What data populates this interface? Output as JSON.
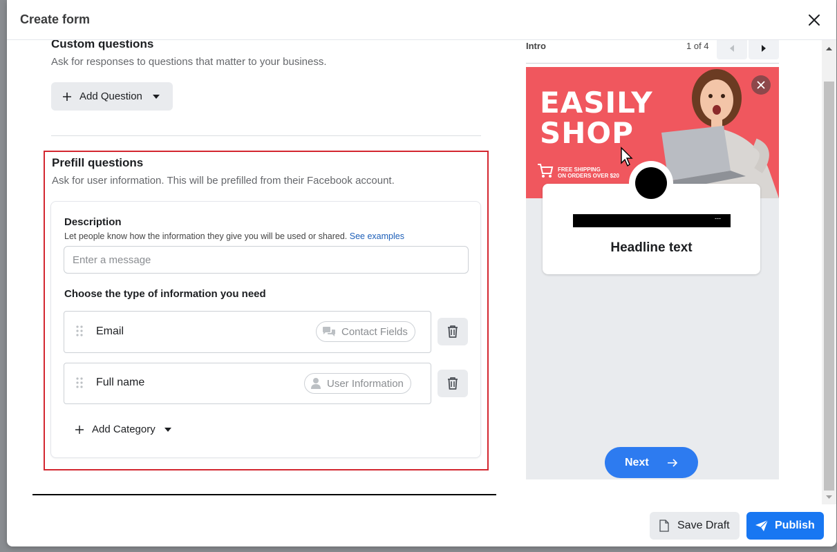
{
  "modal": {
    "title": "Create form"
  },
  "custom_questions": {
    "title": "Custom questions",
    "subtitle": "Ask for responses to questions that matter to your business.",
    "add_button": "Add Question"
  },
  "prefill": {
    "title": "Prefill questions",
    "subtitle": "Ask for user information. This will be prefilled from their Facebook account.",
    "description_label": "Description",
    "description_help": "Let people know how the information they give you will be used or shared.",
    "see_examples": "See examples",
    "message_placeholder": "Enter a message",
    "choose_type_label": "Choose the type of information you need",
    "fields": [
      {
        "name": "Email",
        "category": "Contact Fields"
      },
      {
        "name": "Full name",
        "category": "User Information"
      }
    ],
    "add_category": "Add Category"
  },
  "preview": {
    "section": "Intro",
    "page_counter": "1 of 4",
    "banner_headline": "EASILY\nSHOP",
    "banner_shipping": "FREE SHIPPING\nON ORDERS OVER $20",
    "redacted_suffix": "---",
    "headline": "Headline text",
    "next_button": "Next"
  },
  "footer": {
    "save_draft": "Save Draft",
    "publish": "Publish"
  },
  "colors": {
    "primary": "#1877f2",
    "highlight_border": "#d3262f",
    "banner_bg": "#f0575e",
    "next_button": "#2d7bf0"
  }
}
